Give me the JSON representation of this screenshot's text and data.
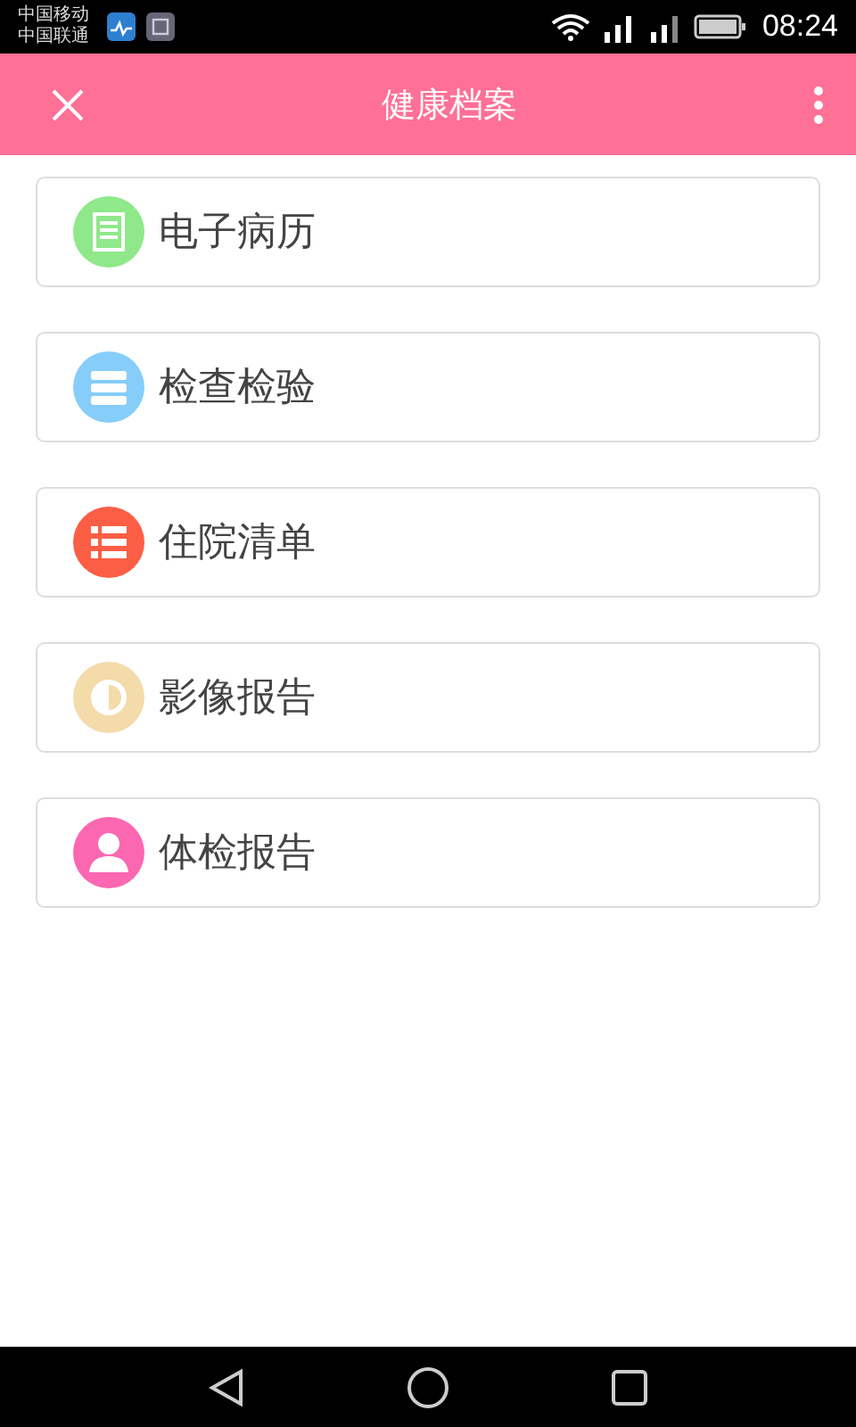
{
  "status_bar": {
    "carriers": [
      "中国移动",
      "中国联通"
    ],
    "time": "08:24"
  },
  "header": {
    "title": "健康档案"
  },
  "items": [
    {
      "label": "电子病历",
      "kind": "record",
      "color": "#8fe88a"
    },
    {
      "label": "检查检验",
      "kind": "tests",
      "color": "#86cdfa"
    },
    {
      "label": "住院清单",
      "kind": "list",
      "color": "#fb5e45"
    },
    {
      "label": "影像报告",
      "kind": "image",
      "color": "#f3dbaa"
    },
    {
      "label": "体检报告",
      "kind": "person",
      "color": "#fc67b2"
    }
  ]
}
